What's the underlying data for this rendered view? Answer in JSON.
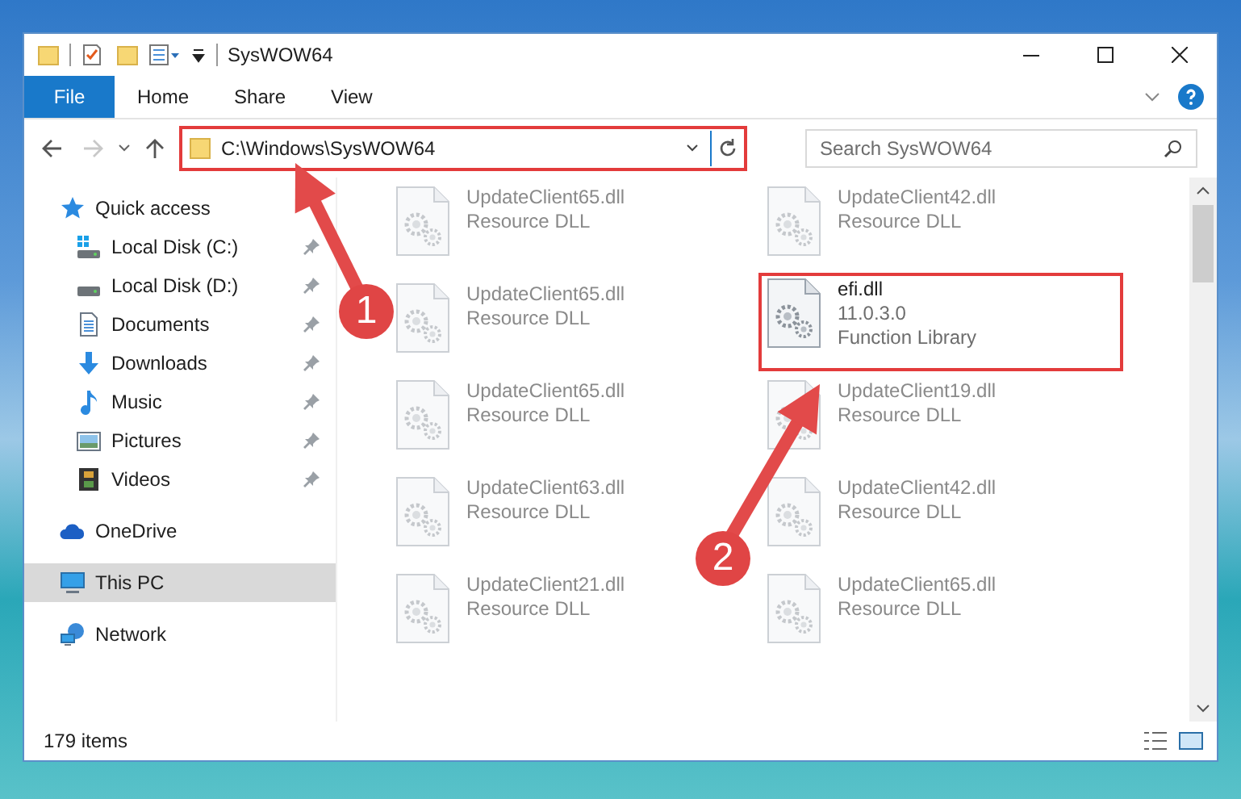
{
  "window": {
    "title": "SysWOW64"
  },
  "ribbon_tabs": [
    {
      "label": "File",
      "selected": true
    },
    {
      "label": "Home",
      "selected": false
    },
    {
      "label": "Share",
      "selected": false
    },
    {
      "label": "View",
      "selected": false
    }
  ],
  "address_bar": {
    "path": "C:\\Windows\\SysWOW64",
    "highlighted": true
  },
  "search": {
    "placeholder": "Search SysWOW64"
  },
  "sidebar": {
    "items": [
      {
        "label": "Quick access",
        "kind": "star",
        "selected": false,
        "children": [
          {
            "label": "Local Disk (C:)",
            "kind": "system-drive",
            "pinned": true
          },
          {
            "label": "Local Disk (D:)",
            "kind": "drive",
            "pinned": true
          },
          {
            "label": "Documents",
            "kind": "documents",
            "pinned": true
          },
          {
            "label": "Downloads",
            "kind": "downloads",
            "pinned": true
          },
          {
            "label": "Music",
            "kind": "music",
            "pinned": true
          },
          {
            "label": "Pictures",
            "kind": "pictures",
            "pinned": true
          },
          {
            "label": "Videos",
            "kind": "videos",
            "pinned": true
          }
        ]
      },
      {
        "label": "OneDrive",
        "kind": "cloud",
        "selected": false
      },
      {
        "label": "This PC",
        "kind": "computer",
        "selected": true
      },
      {
        "label": "Network",
        "kind": "network",
        "selected": false
      }
    ]
  },
  "files": [
    {
      "name": "UpdateClient65.dll",
      "type": "Resource DLL",
      "blurred": true,
      "highlighted": false
    },
    {
      "name": "UpdateClient42.dll",
      "type": "Resource DLL",
      "blurred": true,
      "highlighted": false
    },
    {
      "name": "UpdateClient65.dll",
      "type": "Resource DLL",
      "blurred": true,
      "highlighted": false
    },
    {
      "name": "efi.dll",
      "version": "11.0.3.0",
      "type": "Function Library",
      "blurred": false,
      "highlighted": true
    },
    {
      "name": "UpdateClient65.dll",
      "type": "Resource DLL",
      "blurred": true,
      "highlighted": false
    },
    {
      "name": "UpdateClient19.dll",
      "type": "Resource DLL",
      "blurred": true,
      "highlighted": false
    },
    {
      "name": "UpdateClient63.dll",
      "type": "Resource DLL",
      "blurred": true,
      "highlighted": false
    },
    {
      "name": "UpdateClient42.dll",
      "type": "Resource DLL",
      "blurred": true,
      "highlighted": false
    },
    {
      "name": "UpdateClient21.dll",
      "type": "Resource DLL",
      "blurred": true,
      "highlighted": false
    },
    {
      "name": "UpdateClient65.dll",
      "type": "Resource DLL",
      "blurred": true,
      "highlighted": false
    }
  ],
  "status_bar": {
    "item_count": "179 items"
  },
  "annotations": [
    {
      "number": "1"
    },
    {
      "number": "2"
    }
  ]
}
